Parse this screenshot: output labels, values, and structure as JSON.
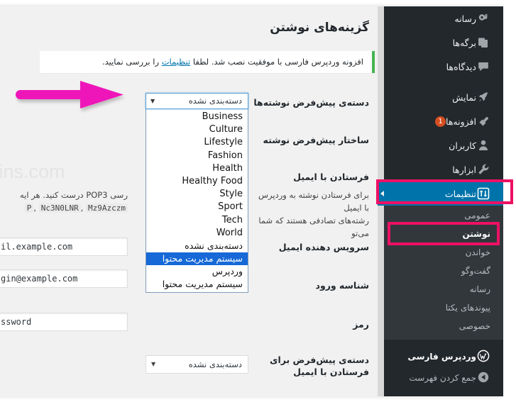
{
  "page": {
    "title": "گزینه‌های نوشتن",
    "watermark": "mins.com"
  },
  "notice": {
    "text_before": "افزونه وردپرس فارسی با موفقیت نصب شد. لطفا ",
    "link": "تنظیمات",
    "text_after": " را بررسی نمایید."
  },
  "form": {
    "default_category_label": "دسته‌ی پیش‌فرض نوشته‌ها",
    "default_post_format_label": "ساختار پیش‌فرض نوشته",
    "post_via_email_label": "فرستادن با ایمیل",
    "post_via_email_desc_line1": "برای فرستادن نوشته به وردپرس با ایمیل",
    "post_via_email_desc_line2": "رشته‌های تصادفی هستند که شما می‌تو",
    "post_via_email_desc_left1": "رسی POP3 درست کنید. هر ایه",
    "code1": "P",
    "code2": "Nc3N0LNR",
    "code3": "Mz9Azczm",
    "mail_server_label": "سرویس دهنده ایمیل",
    "mail_server_value": "il.example.com",
    "login_name_label": "شناسه ورود",
    "login_name_value": "gin@example.com",
    "password_label": "رمز",
    "password_value": "ssword",
    "default_mail_category_label_line1": "دسته‌ی پیش‌فرض برای",
    "default_mail_category_label_line2": "فرستادن با ایمیل",
    "default_mail_category_value": "دسته‌بندی نشده"
  },
  "dropdown": {
    "trigger_value": "دسته‌بندی نشده",
    "caret": "▼",
    "options": [
      {
        "label": "Business",
        "latin": true,
        "selected": false
      },
      {
        "label": "Culture",
        "latin": true,
        "selected": false
      },
      {
        "label": "Lifestyle",
        "latin": true,
        "selected": false
      },
      {
        "label": "Fashion",
        "latin": true,
        "selected": false
      },
      {
        "label": "Health",
        "latin": true,
        "selected": false
      },
      {
        "label": "Healthy Food",
        "latin": true,
        "selected": false
      },
      {
        "label": "Style",
        "latin": true,
        "selected": false
      },
      {
        "label": "Sport",
        "latin": true,
        "selected": false
      },
      {
        "label": "Tech",
        "latin": true,
        "selected": false
      },
      {
        "label": "World",
        "latin": true,
        "selected": false
      },
      {
        "label": "دسته‌بندی نشده",
        "latin": false,
        "selected": false
      },
      {
        "label": "سیستم مدیریت محتوا",
        "latin": false,
        "selected": true
      },
      {
        "label": "وردپرس",
        "latin": false,
        "selected": false
      },
      {
        "label": "سیستم مدیریت محتوا",
        "latin": false,
        "selected": false
      }
    ]
  },
  "sidebar": {
    "items": [
      {
        "label": "رسانه",
        "icon": "media-icon",
        "active": false,
        "badge": null
      },
      {
        "label": "برگه‌ها",
        "icon": "pages-icon",
        "active": false,
        "badge": null
      },
      {
        "label": "دیدگاه‌ها",
        "icon": "comments-icon",
        "active": false,
        "badge": null
      },
      {
        "label": "نمایش",
        "icon": "appearance-icon",
        "active": false,
        "badge": null
      },
      {
        "label": "افزونه‌ها",
        "icon": "plugins-icon",
        "active": false,
        "badge": "1"
      },
      {
        "label": "کاربران",
        "icon": "users-icon",
        "active": false,
        "badge": null
      },
      {
        "label": "ابزارها",
        "icon": "tools-icon",
        "active": false,
        "badge": null
      },
      {
        "label": "تنظیمات",
        "icon": "settings-icon",
        "active": true,
        "badge": null
      }
    ],
    "submenu": [
      {
        "label": "عمومی",
        "current": false
      },
      {
        "label": "نوشتن",
        "current": true
      },
      {
        "label": "خواندن",
        "current": false
      },
      {
        "label": "گفت‌وگو",
        "current": false
      },
      {
        "label": "رسانه",
        "current": false
      },
      {
        "label": "پیوندهای یکتا",
        "current": false
      },
      {
        "label": "خصوصی",
        "current": false
      }
    ],
    "footer": [
      {
        "label": "وردپرس فارسی",
        "icon": "wp-fa-icon",
        "bold": true
      },
      {
        "label": "جمع کردن فهرست",
        "icon": "collapse-icon",
        "bold": false
      }
    ]
  },
  "annotations": {
    "arrow_color": "#ef19b9",
    "box_color": "#ed1164"
  }
}
